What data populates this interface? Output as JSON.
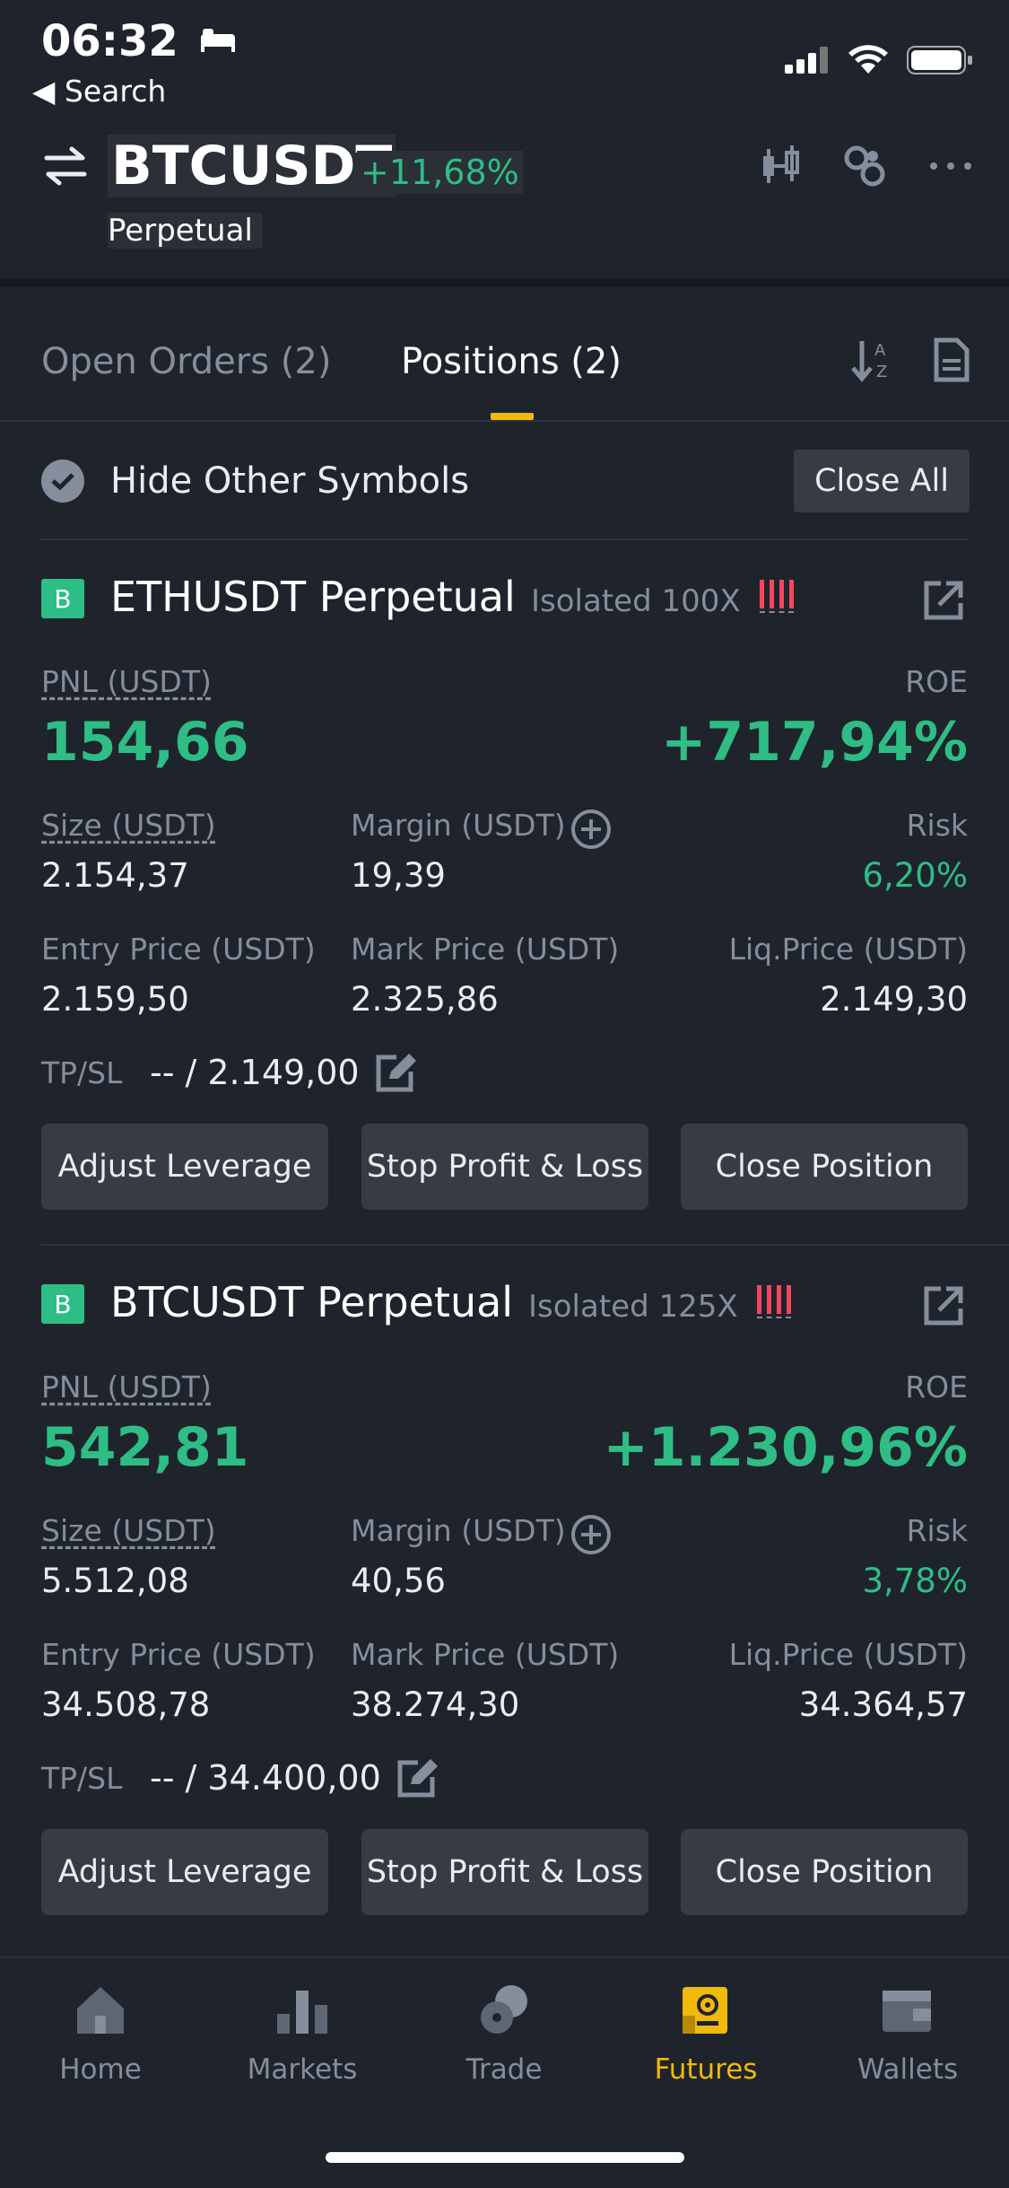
{
  "status": {
    "time": "06:32",
    "back_label": "Search"
  },
  "header": {
    "symbol": "BTCUSDT",
    "change": "+11,68%",
    "contract": "Perpetual"
  },
  "tabs": [
    {
      "label": "Open Orders (2)"
    },
    {
      "label": "Positions  (2)"
    }
  ],
  "filter": {
    "hide_label": "Hide Other Symbols",
    "close_all": "Close All"
  },
  "labels": {
    "pnl": "PNL (USDT)",
    "roe": "ROE",
    "size": "Size (USDT)",
    "margin": "Margin (USDT)",
    "risk": "Risk",
    "entry": "Entry Price (USDT)",
    "mark": "Mark Price (USDT)",
    "liq": "Liq.Price (USDT)",
    "tpsl": "TP/SL",
    "adjust": "Adjust Leverage",
    "stop": "Stop Profit & Loss",
    "close": "Close Position"
  },
  "positions": [
    {
      "side": "B",
      "title": "ETHUSDT Perpetual",
      "mode": "Isolated 100X",
      "pnl": "154,66",
      "roe": "+717,94%",
      "size": "2.154,37",
      "margin": "19,39",
      "risk": "6,20%",
      "entry": "2.159,50",
      "mark": "2.325,86",
      "liq": "2.149,30",
      "tpsl": "-- / 2.149,00"
    },
    {
      "side": "B",
      "title": "BTCUSDT Perpetual",
      "mode": "Isolated 125X",
      "pnl": "542,81",
      "roe": "+1.230,96%",
      "size": "5.512,08",
      "margin": "40,56",
      "risk": "3,78%",
      "entry": "34.508,78",
      "mark": "38.274,30",
      "liq": "34.364,57",
      "tpsl": "-- / 34.400,00"
    }
  ],
  "nav": [
    {
      "label": "Home",
      "icon": "home-icon"
    },
    {
      "label": "Markets",
      "icon": "markets-icon"
    },
    {
      "label": "Trade",
      "icon": "trade-icon"
    },
    {
      "label": "Futures",
      "icon": "futures-icon",
      "active": true
    },
    {
      "label": "Wallets",
      "icon": "wallet-icon"
    }
  ],
  "colors": {
    "green": "#2ebd85",
    "red": "#f6465d",
    "accent": "#f0b90b",
    "bg": "#1f232c"
  }
}
